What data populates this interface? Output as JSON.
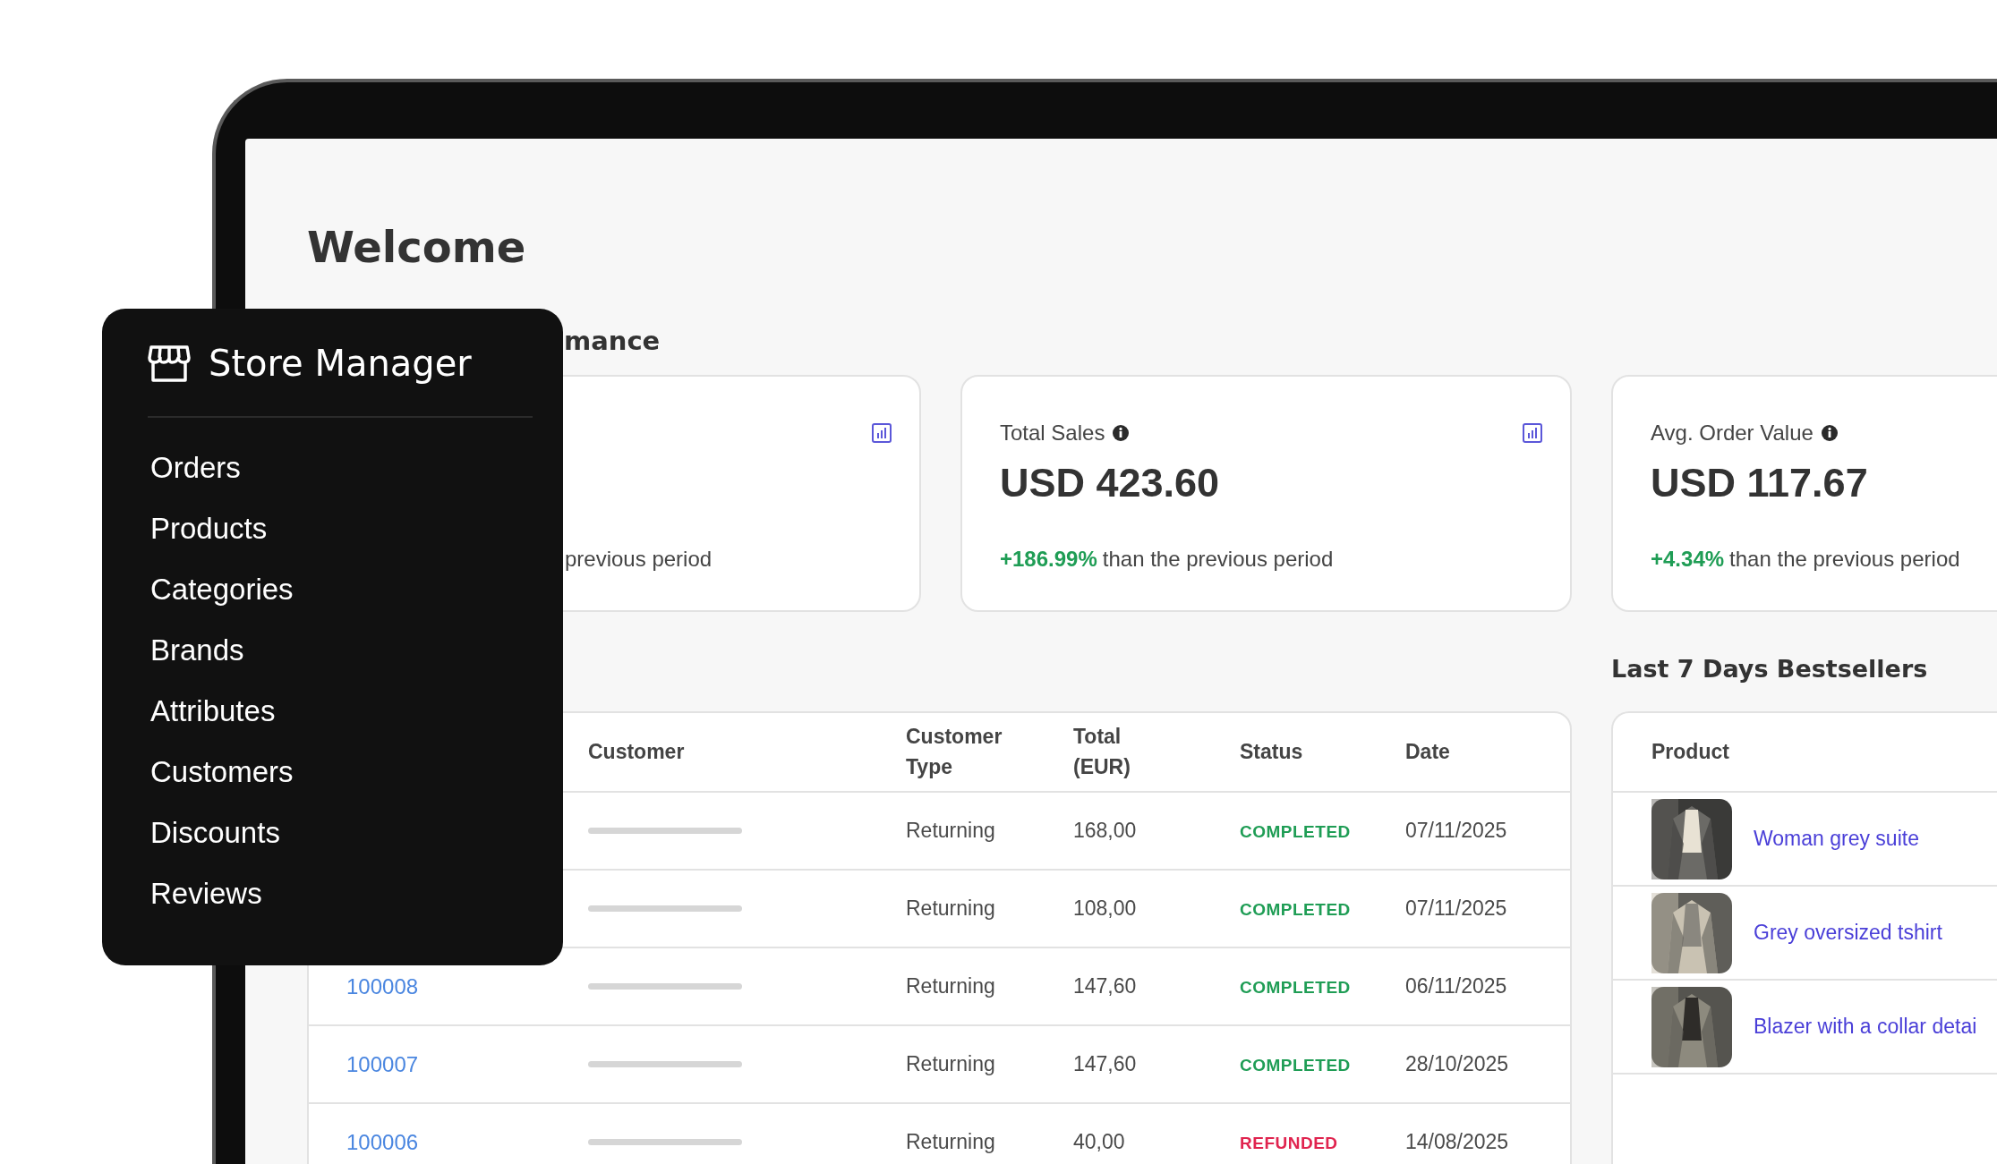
{
  "page": {
    "title": "Welcome",
    "section_heading": "mance"
  },
  "stats": [
    {
      "comparison": "previous period",
      "chart_icon": true
    },
    {
      "label": "Total Sales",
      "value": "USD 423.60",
      "change": "+186.99%",
      "comparison": "than the previous period",
      "chart_icon": true
    },
    {
      "label": "Avg. Order Value",
      "value": "USD 117.67",
      "change": "+4.34%",
      "comparison": "than the previous period"
    }
  ],
  "orders": {
    "columns": [
      "Customer",
      "Customer Type",
      "Total (EUR)",
      "Status",
      "Date"
    ],
    "rows": [
      {
        "customer_type": "Returning",
        "total": "168,00",
        "status": "COMPLETED",
        "color": "#1f9d55",
        "date": "07/11/2025"
      },
      {
        "customer_type": "Returning",
        "total": "108,00",
        "status": "COMPLETED",
        "color": "#1f9d55",
        "date": "07/11/2025"
      },
      {
        "order": "100008",
        "customer_type": "Returning",
        "total": "147,60",
        "status": "COMPLETED",
        "color": "#1f9d55",
        "date": "06/11/2025"
      },
      {
        "order": "100007",
        "customer_type": "Returning",
        "total": "147,60",
        "status": "COMPLETED",
        "color": "#1f9d55",
        "date": "28/10/2025"
      },
      {
        "order": "100006",
        "customer_type": "Returning",
        "total": "40,00",
        "status": "REFUNDED",
        "color": "#e0244f",
        "date": "14/08/2025"
      }
    ]
  },
  "bestsellers": {
    "title": "Last 7 Days Bestsellers",
    "column": "Product",
    "items": [
      {
        "name": "Woman grey suite"
      },
      {
        "name": "Grey oversized tshirt"
      },
      {
        "name": "Blazer with a collar detai"
      }
    ]
  },
  "sidebar": {
    "title": "Store Manager",
    "items": [
      "Orders",
      "Products",
      "Categories",
      "Brands",
      "Attributes",
      "Customers",
      "Discounts",
      "Reviews"
    ]
  }
}
